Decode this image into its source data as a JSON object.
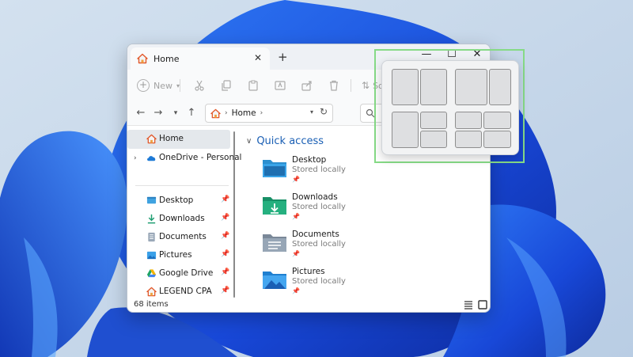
{
  "window": {
    "tab_title": "Home",
    "tab_close": "✕",
    "new_tab": "+",
    "controls": {
      "minimize": "—",
      "maximize": "☐",
      "close": "✕"
    }
  },
  "toolbar": {
    "new_label": "New",
    "sort_label": "So",
    "icons": [
      "cut-icon",
      "copy-icon",
      "paste-icon",
      "rename-icon",
      "share-icon",
      "delete-icon",
      "sort-icon"
    ]
  },
  "address": {
    "location": "Home",
    "search_placeholder": ""
  },
  "sidebar": {
    "items": [
      {
        "label": "Home",
        "icon": "home-icon",
        "selected": true
      },
      {
        "label": "OneDrive - Personal",
        "icon": "cloud-icon"
      },
      {
        "label": "Desktop",
        "icon": "desktop-icon",
        "pinned": true
      },
      {
        "label": "Downloads",
        "icon": "download-icon",
        "pinned": true
      },
      {
        "label": "Documents",
        "icon": "documents-icon",
        "pinned": true
      },
      {
        "label": "Pictures",
        "icon": "pictures-icon",
        "pinned": true
      },
      {
        "label": "Google Drive",
        "icon": "google-drive-icon",
        "pinned": true
      },
      {
        "label": "LEGEND CPA",
        "icon": "home-icon",
        "pinned": true
      }
    ]
  },
  "content": {
    "section_title": "Quick access",
    "items": [
      {
        "name": "Desktop",
        "sub": "Stored locally",
        "icon": "desktop-folder-icon"
      },
      {
        "name": "Downloads",
        "sub": "Stored locally",
        "icon": "downloads-folder-icon"
      },
      {
        "name": "Documents",
        "sub": "Stored locally",
        "icon": "documents-folder-icon"
      },
      {
        "name": "Pictures",
        "sub": "Stored locally",
        "icon": "pictures-folder-icon"
      }
    ]
  },
  "status": {
    "item_count": "68 items"
  },
  "colors": {
    "accent": "#1a5fb4",
    "snap_highlight": "#86da86",
    "wallpaper_blue": "#1f5fe0"
  }
}
